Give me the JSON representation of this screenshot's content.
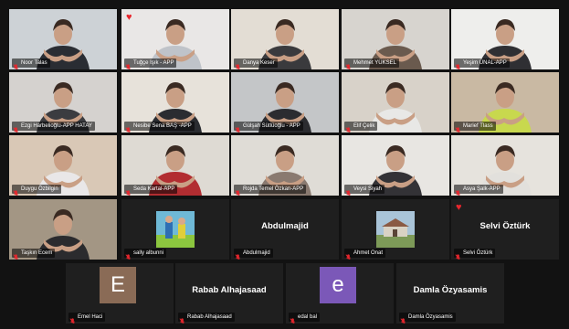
{
  "participants": [
    {
      "name": "Noor Talas"
    },
    {
      "name": "Tuğçe Işık - APP",
      "reaction": "heart"
    },
    {
      "name": "Danya Keser"
    },
    {
      "name": "Mehmet YÜKSEL"
    },
    {
      "name": "Yeşim ÜNAL-APP",
      "active": true
    },
    {
      "name": "Ezgi Harbelioğlu-APP HATAY"
    },
    {
      "name": "Nesibe Sena BAŞ -APP"
    },
    {
      "name": "Gülşah Sütlüoğlu - APP"
    },
    {
      "name": "Elif Çelik"
    },
    {
      "name": "Marief Tlass"
    },
    {
      "name": "Duygu Özbilgin"
    },
    {
      "name": "Seda Kartal-APP"
    },
    {
      "name": "Rojda Temel Özkan-APP"
    },
    {
      "name": "Veysi Siyah"
    },
    {
      "name": "Asya Şalk-APP"
    },
    {
      "name": "Taşkın Ecem"
    },
    {
      "name": "sally albunni"
    },
    {
      "name": "Abdulmajid",
      "display_name": "Abdulmajid"
    },
    {
      "name": "Ahmet Onat"
    },
    {
      "name": "Selvi Öztürk",
      "display_name": "Selvi Öztürk",
      "reaction": "heart"
    },
    {
      "name": "Emel Haci",
      "avatar_letter": "E",
      "avatar_color": "#8a6b56"
    },
    {
      "name": "Rabab Alhajasaad",
      "display_name": "Rabab Alhajasaad"
    },
    {
      "name": "edal bal",
      "avatar_letter": "e",
      "avatar_color": "#7b58b8"
    },
    {
      "name": "Damla Özyasamis",
      "display_name": "Damla Özyasamis"
    }
  ],
  "icons": {
    "muted": "microphone-muted-icon",
    "reaction": "heart-icon"
  },
  "colors": {
    "muted": "#e8262d",
    "active_border": "#b7d84a",
    "tile_bg": "#1f1f1f"
  }
}
